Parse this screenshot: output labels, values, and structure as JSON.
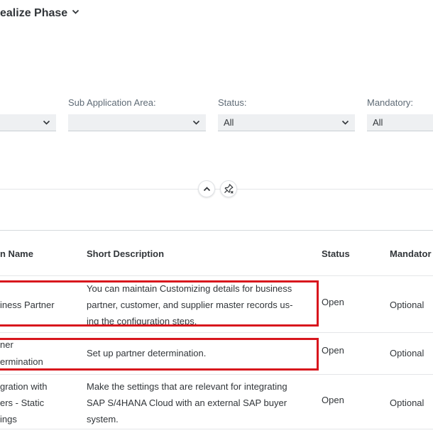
{
  "header": {
    "title": "ealize Phase",
    "colors": {
      "text": "#32363a",
      "label": "#5f6b76",
      "highlight": "#d8161d"
    }
  },
  "filters": {
    "first": {
      "value": ""
    },
    "sub_application_area": {
      "label": "Sub Application Area:",
      "value": ""
    },
    "status": {
      "label": "Status:",
      "value": "All"
    },
    "mandatory": {
      "label": "Mandatory:",
      "value": "All"
    }
  },
  "toolbar": {
    "collapse_icon": "chevron-up-icon",
    "pin_icon": "unpin-icon"
  },
  "table": {
    "columns": [
      "n Name",
      "Short Description",
      "Status",
      "Mandator"
    ],
    "rows": [
      {
        "name_lines": [
          "iness Partner"
        ],
        "description_lines": [
          "You can maintain Customizing details for business",
          "partner, customer, and supplier master records us-",
          "ing the configuration steps."
        ],
        "status": "Open",
        "mandatory": "Optional"
      },
      {
        "name_lines": [
          "ner",
          "ermination"
        ],
        "description_lines": [
          "Set up partner determination."
        ],
        "status": "Open",
        "mandatory": "Optional"
      },
      {
        "name_lines": [
          "gration with",
          "ers - Static",
          "ings"
        ],
        "description_lines": [
          "Make the settings that are relevant for integrating",
          "SAP S/4HANA Cloud with an external SAP buyer",
          "system."
        ],
        "status": "Open",
        "mandatory": "Optional"
      }
    ]
  }
}
